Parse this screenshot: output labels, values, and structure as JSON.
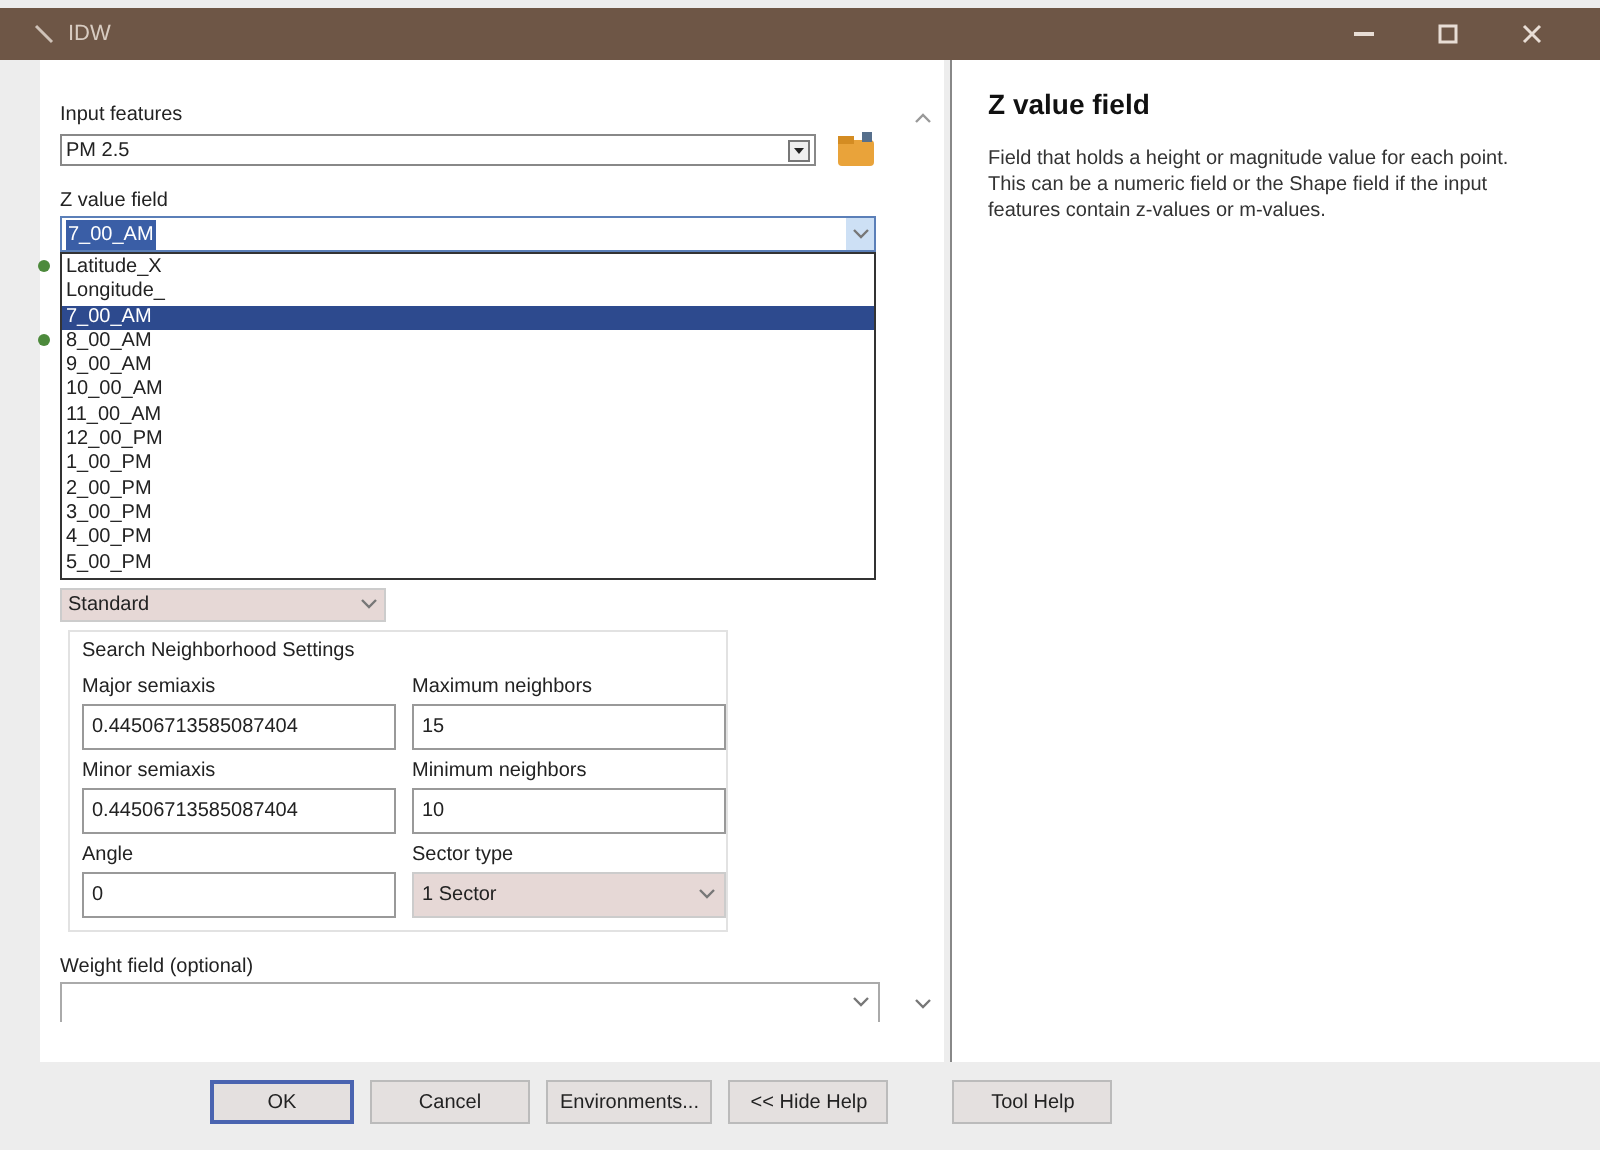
{
  "window": {
    "title": "IDW"
  },
  "input_features": {
    "label": "Input features",
    "value": "PM 2.5"
  },
  "z_value_field": {
    "label": "Z value field",
    "value": "7_00_AM",
    "expanded": true,
    "options": [
      {
        "label": "Latitude_X",
        "selected": false,
        "required_mark": true
      },
      {
        "label": "Longitude_",
        "selected": false,
        "required_mark": false
      },
      {
        "label": "7_00_AM",
        "selected": true,
        "required_mark": false
      },
      {
        "label": "8_00_AM",
        "selected": false,
        "required_mark": true
      },
      {
        "label": "9_00_AM",
        "selected": false,
        "required_mark": false
      },
      {
        "label": "10_00_AM",
        "selected": false,
        "required_mark": false
      },
      {
        "label": "11_00_AM",
        "selected": false,
        "required_mark": false
      },
      {
        "label": "12_00_PM",
        "selected": false,
        "required_mark": false
      },
      {
        "label": "1_00_PM",
        "selected": false,
        "required_mark": false
      },
      {
        "label": "2_00_PM",
        "selected": false,
        "required_mark": false
      },
      {
        "label": "3_00_PM",
        "selected": false,
        "required_mark": false
      },
      {
        "label": "4_00_PM",
        "selected": false,
        "required_mark": false
      },
      {
        "label": "5_00_PM",
        "selected": false,
        "required_mark": false
      }
    ]
  },
  "search_neighborhood": {
    "type_value": "Standard",
    "title": "Search Neighborhood Settings",
    "fields": [
      {
        "label": "Major semiaxis",
        "value": "0.44506713585087404",
        "kind": "text"
      },
      {
        "label": "Maximum neighbors",
        "value": "15",
        "kind": "text"
      },
      {
        "label": "Minor semiaxis",
        "value": "0.44506713585087404",
        "kind": "text"
      },
      {
        "label": "Minimum neighbors",
        "value": "10",
        "kind": "text"
      },
      {
        "label": "Angle",
        "value": "0",
        "kind": "text"
      },
      {
        "label": "Sector type",
        "value": "1 Sector",
        "kind": "select"
      }
    ]
  },
  "weight_field": {
    "label": "Weight field (optional)"
  },
  "buttons": [
    {
      "label": "OK",
      "selected": true
    },
    {
      "label": "Cancel",
      "selected": false
    },
    {
      "label": "Environments...",
      "selected": false
    },
    {
      "label": "<< Hide Help",
      "selected": false
    },
    {
      "label": "Tool Help",
      "selected": false
    }
  ],
  "help": {
    "title": "Z value field",
    "text": "Field that holds a height or magnitude value for each point. This can be a numeric field or the Shape field if the input features contain z-values or m-values."
  }
}
